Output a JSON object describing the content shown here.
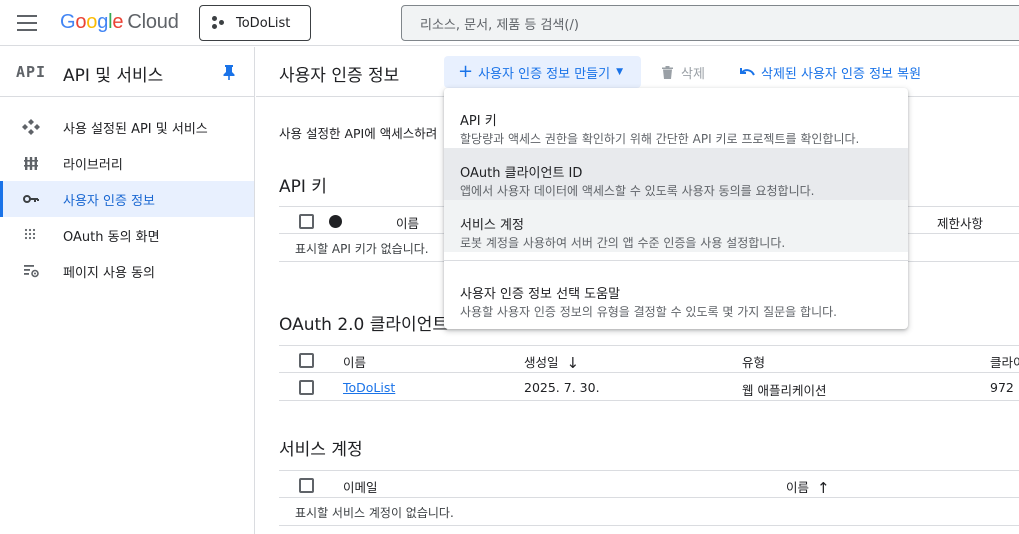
{
  "topbar": {
    "logo_letters": [
      "G",
      "o",
      "o",
      "g",
      "l",
      "e"
    ],
    "logo_cloud": "Cloud",
    "project": "ToDoList",
    "search_placeholder": "리소스, 문서, 제품 등 검색(/)"
  },
  "sidebar": {
    "badge": "API",
    "title": "API 및 서비스",
    "items": [
      {
        "label": "사용 설정된 API 및 서비스",
        "icon": "diamond-icon",
        "active": false
      },
      {
        "label": "라이브러리",
        "icon": "library-icon",
        "active": false
      },
      {
        "label": "사용자 인증 정보",
        "icon": "key-icon",
        "active": true
      },
      {
        "label": "OAuth 동의 화면",
        "icon": "dots-grid-icon",
        "active": false
      },
      {
        "label": "페이지 사용 동의",
        "icon": "settings-list-icon",
        "active": false
      }
    ]
  },
  "main": {
    "title": "사용자 인증 정보",
    "create_label": "사용자 인증 정보 만들기",
    "delete_label": "삭제",
    "restore_label": "삭제된 사용자 인증 정보 복원",
    "intro": "사용 설정한 API에 액세스하려"
  },
  "api_keys": {
    "title": "API 키",
    "col_name": "이름",
    "col_restrictions": "제한사항",
    "empty": "표시할 API 키가 없습니다."
  },
  "oauth": {
    "title": "OAuth 2.0 클라이언트",
    "col_name": "이름",
    "col_created": "생성일",
    "col_type": "유형",
    "col_client": "클라이",
    "rows": [
      {
        "name": "ToDoList",
        "created": "2025. 7. 30.",
        "type": "웹 애플리케이션",
        "client_id": "972"
      }
    ]
  },
  "service_accounts": {
    "title": "서비스 계정",
    "col_email": "이메일",
    "col_name": "이름",
    "empty": "표시할 서비스 계정이 없습니다."
  },
  "menu": {
    "items": [
      {
        "title": "API 키",
        "desc": "할당량과 액세스 권한을 확인하기 위해 간단한 API 키로 프로젝트를 확인합니다."
      },
      {
        "title": "OAuth 클라이언트 ID",
        "desc": "앱에서 사용자 데이터에 액세스할 수 있도록 사용자 동의를 요청합니다."
      },
      {
        "title": "서비스 계정",
        "desc": "로봇 계정을 사용하여 서버 간의 앱 수준 인증을 사용 설정합니다."
      },
      {
        "title": "사용자 인증 정보 선택 도움말",
        "desc": "사용할 사용자 인증 정보의 유형을 결정할 수 있도록 몇 가지 질문을 합니다."
      }
    ]
  },
  "colors": {
    "accent": "#1a73e8",
    "active_bg": "#e8f0fe"
  }
}
